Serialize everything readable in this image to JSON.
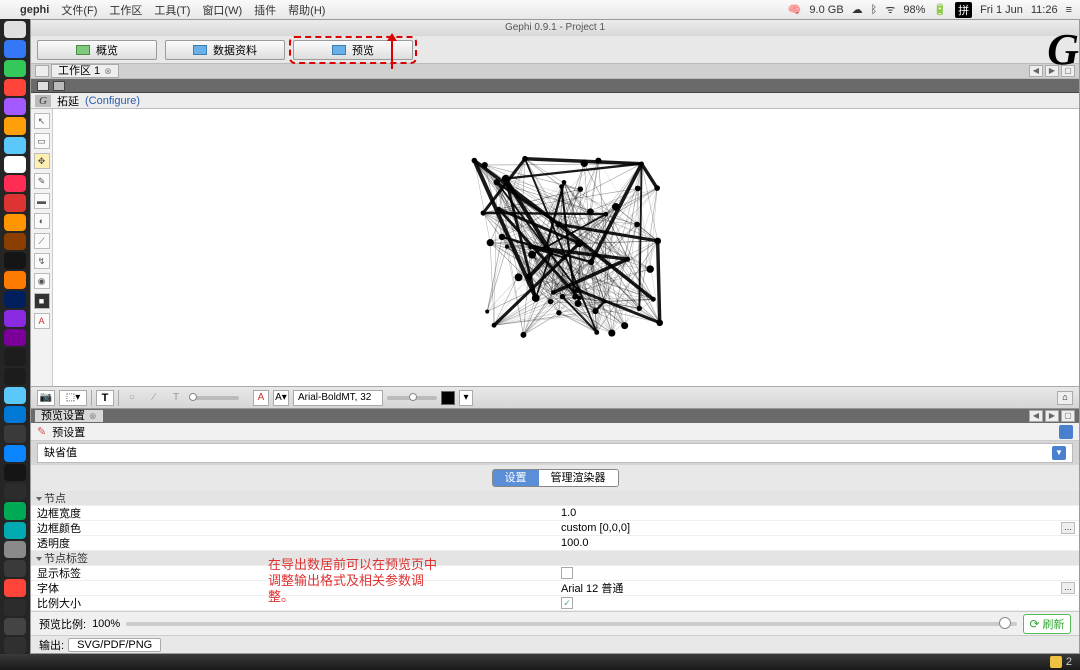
{
  "menubar": {
    "apple": "",
    "app": "gephi",
    "items": [
      "文件(F)",
      "工作区",
      "工具(T)",
      "窗口(W)",
      "插件",
      "帮助(H)"
    ],
    "mem": "9.0 GB",
    "battery": "98%",
    "ime": "拼",
    "date": "Fri 1 Jun",
    "time": "11:26"
  },
  "window_title": "Gephi 0.9.1 - Project 1",
  "perspectives": {
    "overview": "概览",
    "datalab": "数据资料",
    "preview": "预览"
  },
  "workspace_tab": "工作区 1",
  "graph_header": {
    "label": "拓延",
    "configure": "(Configure)"
  },
  "font_field": "Arial-BoldMT, 32",
  "preview_panel_title": "预览设置",
  "preset_label": "预设置",
  "preset_value": "缺省值",
  "segments": {
    "settings": "设置",
    "renderers": "管理渲染器"
  },
  "props": {
    "node_hdr": "节点",
    "border_width_k": "边框宽度",
    "border_width_v": "1.0",
    "border_color_k": "边框颜色",
    "border_color_v": "custom [0,0,0]",
    "opacity_k": "透明度",
    "opacity_v": "100.0",
    "nodelabel_hdr": "节点标签",
    "showlabel_k": "显示标签",
    "font_k": "字体",
    "font_v": "Arial 12 普通",
    "proportional_k": "比例大小"
  },
  "annotation_text": "在导出数居前可以在预览页中调整输出格式及相关参数调整。",
  "ratio": {
    "label": "预览比例:",
    "value": "100%"
  },
  "refresh_label": "刷新",
  "export": {
    "label": "输出:",
    "btn": "SVG/PDF/PNG"
  },
  "statusbar_num": "2",
  "dock_colors": [
    "#e0e0e0",
    "#3478f6",
    "#34c759",
    "#ff453a",
    "#a259ff",
    "#ff9f0a",
    "#5ac8fa",
    "#ffffff",
    "#ff2d55",
    "#d33",
    "#ff9500",
    "#8a3f00",
    "#151515",
    "#ff7a00",
    "#001f5c",
    "#8a2be2",
    "#7a0099",
    "#1d1d1d",
    "#1c1c1c",
    "#5ac8fa",
    "#0079d6",
    "#3a3a3a",
    "#0a84ff",
    "#151515",
    "#2c2c2c",
    "#00aa55",
    "#00aab0",
    "#8a8a8a",
    "#3a3a3a",
    "#ff453a",
    "#2c2c2c",
    "#444444",
    "#303030"
  ]
}
